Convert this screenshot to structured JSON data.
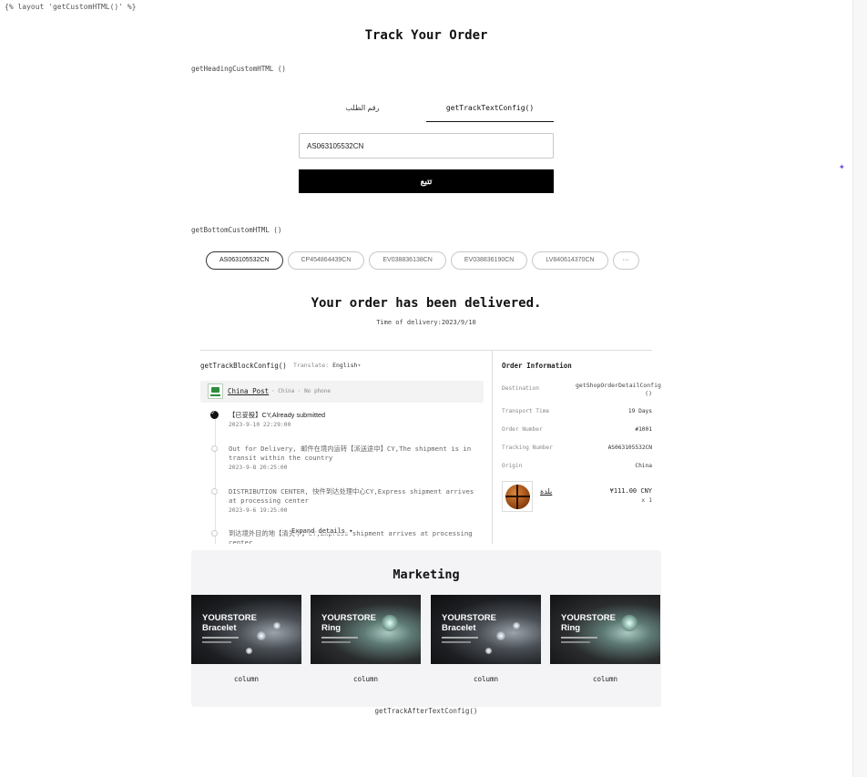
{
  "layout_tag": "{% layout 'getCustomHTML()' %}",
  "title": "Track Your Order",
  "heading_custom": "getHeadingCustomHTML ()",
  "tabs": [
    {
      "label": "رقم الطلب"
    },
    {
      "label": "getTrackTextConfig()"
    }
  ],
  "search": {
    "value": "AS063105532CN"
  },
  "track_button_label": "تتبع",
  "bottom_custom": "getBottomCustomHTML ()",
  "tracking_numbers": [
    "AS063105532CN",
    "CP454864439CN",
    "EV038836138CN",
    "EV038836190CN",
    "LV840614370CN"
  ],
  "more_chip": "···",
  "status": {
    "title": "Your order has been delivered.",
    "delivery_time": "Time of delivery:2023/9/10"
  },
  "tracking": {
    "block_config": "getTrackBlockConfig()",
    "translate_label": "Translate:",
    "translate_value": "English",
    "carrier_name": "China Post",
    "carrier_meta": "· China · No phone",
    "events": [
      {
        "text": "【已妥投】CY,Already submitted",
        "time": "2023-9-10 22:29:00"
      },
      {
        "text": "Out for Delivery, 邮件在境内运转【派送途中】CY,The shipment is in transit within the country",
        "time": "2023-9-8 20:25:00"
      },
      {
        "text": "DISTRIBUTION CENTER, 快件到达处理中心CY,Express shipment arrives at processing center",
        "time": "2023-9-6 19:25:00"
      },
      {
        "text": "到达境外目的地【清关中】CY,Express shipment arrives at processing center",
        "time": ""
      }
    ],
    "expand_label": "Expand details"
  },
  "order_info": {
    "title": "Order Information",
    "rows": [
      {
        "label": "Destination",
        "value": "getShopOrderDetailConfig ()"
      },
      {
        "label": "Transport Time",
        "value": "19 Days"
      },
      {
        "label": "Order Number",
        "value": "#1001"
      },
      {
        "label": "Tracking Number",
        "value": "AS063105532CN"
      },
      {
        "label": "Origin",
        "value": "China"
      }
    ],
    "product": {
      "name": "بلدة",
      "price": "¥111.00 CNY",
      "qty": "x 1"
    }
  },
  "marketing": {
    "title": "Marketing",
    "cards": [
      {
        "brand": "YOURSTORE",
        "product": "Bracelet",
        "label": "column"
      },
      {
        "brand": "YOURSTORE",
        "product": "Ring",
        "label": "column"
      },
      {
        "brand": "YOURSTORE",
        "product": "Bracelet",
        "label": "column"
      },
      {
        "brand": "YOURSTORE",
        "product": "Ring",
        "label": "column"
      }
    ]
  },
  "after_text": "getTrackAfterTextConfig()",
  "colors": {
    "accent": "#000000",
    "panel_bg": "#f4f4f6",
    "sparkle": "#6d3ff0"
  },
  "icons": [
    "sparkle-icon",
    "check-icon",
    "chevron-down-icon",
    "china-post-logo"
  ]
}
